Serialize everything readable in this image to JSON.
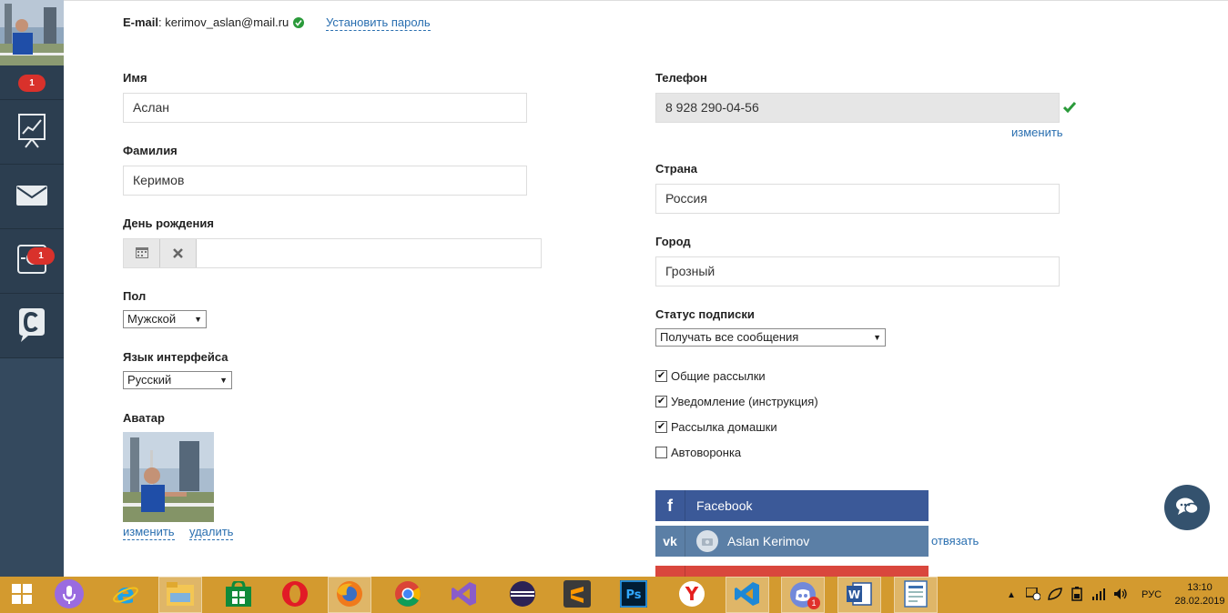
{
  "sidebar": {
    "profile_badge": "1",
    "items": [
      {
        "icon": "chart-presentation-icon"
      },
      {
        "icon": "envelope-icon"
      },
      {
        "icon": "settings-icon",
        "badge": "1"
      },
      {
        "icon": "chat-logo-icon"
      }
    ]
  },
  "header": {
    "email_label": "E-mail",
    "email_value": ": kerimov_aslan@mail.ru",
    "set_password_link": "Установить пароль"
  },
  "form": {
    "first_name": {
      "label": "Имя",
      "value": "Аслан"
    },
    "last_name": {
      "label": "Фамилия",
      "value": "Керимов"
    },
    "birthday": {
      "label": "День рождения",
      "value": ""
    },
    "gender": {
      "label": "Пол",
      "selected": "Мужской"
    },
    "language": {
      "label": "Язык интерфейса",
      "selected": "Русский"
    },
    "avatar": {
      "label": "Аватар",
      "change_link": "изменить",
      "delete_link": "удалить"
    },
    "phone": {
      "label": "Телефон",
      "value": "8 928 290-04-56",
      "change_link": "изменить"
    },
    "country": {
      "label": "Страна",
      "value": "Россия"
    },
    "city": {
      "label": "Город",
      "value": "Грозный"
    },
    "subscription": {
      "label": "Статус подписки",
      "selected": "Получать все сообщения"
    },
    "checkboxes": [
      {
        "label": "Общие рассылки",
        "checked": true
      },
      {
        "label": "Уведомление (инструкция)",
        "checked": true
      },
      {
        "label": "Рассылка домашки",
        "checked": true
      },
      {
        "label": "Автоворонка",
        "checked": false
      }
    ]
  },
  "social": {
    "facebook": {
      "label": "Facebook",
      "color": "#3b5998"
    },
    "vk": {
      "label": "Aslan Kerimov",
      "unlink": "отвязать",
      "color": "#5b7fa6"
    },
    "third_color": "#d9473d"
  },
  "taskbar": {
    "language": "РУС",
    "time": "13:10",
    "date": "28.02.2019",
    "discord_badge": "1"
  },
  "colors": {
    "sidebar": "#2c3e50",
    "link": "#2a6fb0",
    "badge": "#d9312b",
    "taskbar": "#d39a2f",
    "check_green": "#2a9a3a"
  }
}
